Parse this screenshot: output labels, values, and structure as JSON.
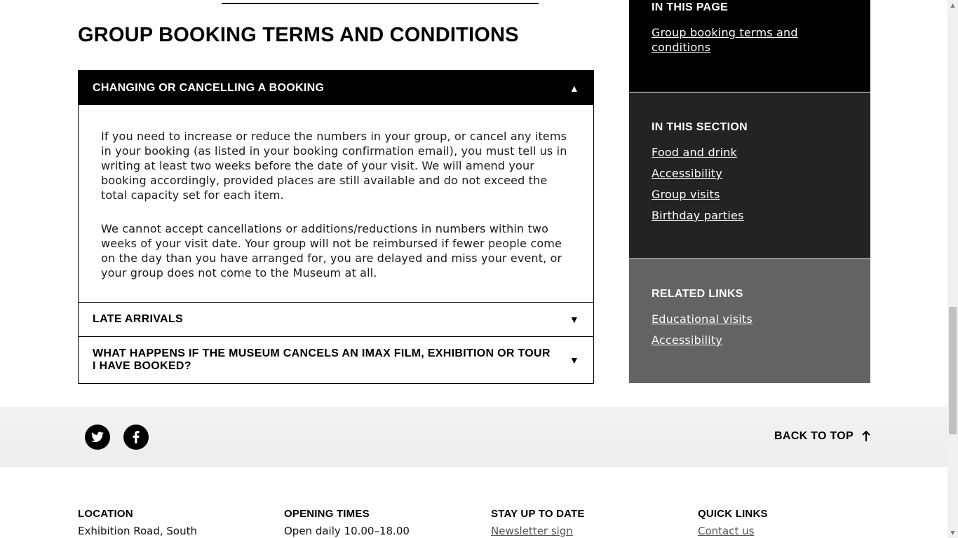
{
  "main": {
    "heading": "GROUP BOOKING TERMS AND CONDITIONS",
    "accordion": [
      {
        "title": "CHANGING OR CANCELLING A BOOKING",
        "expanded": true,
        "arrow": "▲",
        "paragraphs": [
          "If you need to increase or reduce the numbers in your group, or cancel any items in your booking (as listed in your booking confirmation email), you must tell us in writing at least two weeks before the date of your visit. We will amend your booking accordingly, provided places are still available and do not exceed the total capacity set for each item.",
          "We cannot accept cancellations or additions/reductions in numbers within two weeks of your visit date. Your group will not be reimbursed if fewer people come on the day than you have arranged for, you are delayed and miss your event, or your group does not come to the Museum at all."
        ]
      },
      {
        "title": "LATE ARRIVALS",
        "expanded": false,
        "arrow": "▼"
      },
      {
        "title": "WHAT HAPPENS IF THE MUSEUM CANCELS AN IMAX FILM, EXHIBITION OR TOUR I HAVE BOOKED?",
        "expanded": false,
        "arrow": "▼"
      }
    ]
  },
  "sidebar": {
    "in_this_page": {
      "title": "IN THIS PAGE",
      "links": [
        "Group booking terms and conditions"
      ]
    },
    "in_this_section": {
      "title": "IN THIS SECTION",
      "links": [
        "Food and drink",
        "Accessibility",
        "Group visits",
        "Birthday parties"
      ]
    },
    "related_links": {
      "title": "RELATED LINKS",
      "links": [
        "Educational visits",
        "Accessibility"
      ]
    }
  },
  "share": {
    "twitter_icon": "twitter-icon",
    "facebook_icon": "facebook-icon",
    "back_to_top": "BACK TO TOP"
  },
  "footer": {
    "location": {
      "title": "LOCATION",
      "text": "Exhibition Road, South"
    },
    "opening_times": {
      "title": "OPENING TIMES",
      "text": "Open daily 10.00–18.00"
    },
    "stay_up_to_date": {
      "title": "STAY UP TO DATE",
      "link": "Newsletter sign"
    },
    "quick_links": {
      "title": "QUICK LINKS",
      "link": "Contact us"
    }
  },
  "colors": {
    "sidebar_black": "#000000",
    "sidebar_dark": "#232323",
    "sidebar_gray": "#636363",
    "strip_bg": "#f0f0f0"
  }
}
